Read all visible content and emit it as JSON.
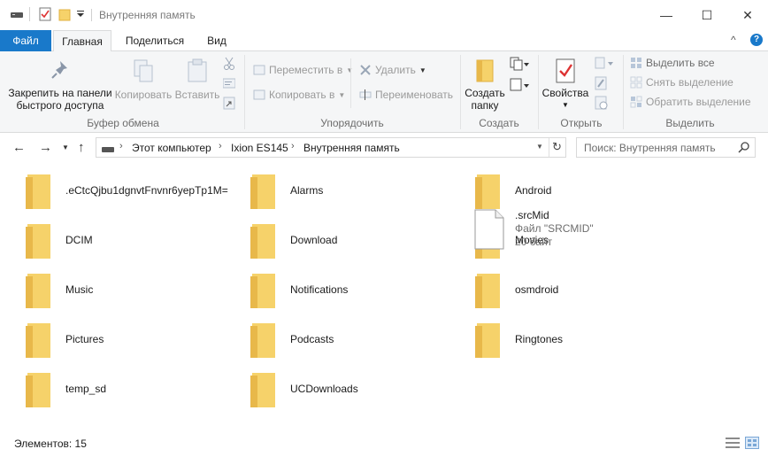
{
  "window": {
    "title": "Внутренняя память",
    "minimize_glyph": "—",
    "maximize_glyph": "☐",
    "close_glyph": "✕"
  },
  "ribbon_tabs": {
    "file": "Файл",
    "home": "Главная",
    "share": "Поделиться",
    "view": "Вид",
    "collapse_glyph": "^",
    "help_glyph": "?"
  },
  "ribbon": {
    "clipboard": {
      "pin_line1": "Закрепить на панели",
      "pin_line2": "быстрого доступа",
      "copy": "Копировать",
      "paste": "Вставить",
      "group": "Буфер обмена"
    },
    "organize": {
      "move_to": "Переместить в",
      "copy_to": "Копировать в",
      "delete": "Удалить",
      "rename": "Переименовать",
      "group": "Упорядочить"
    },
    "new": {
      "new_folder_line1": "Создать",
      "new_folder_line2": "папку",
      "group": "Создать"
    },
    "open": {
      "properties": "Свойства",
      "group": "Открыть"
    },
    "select": {
      "select_all": "Выделить все",
      "select_none": "Снять выделение",
      "invert": "Обратить выделение",
      "group": "Выделить"
    }
  },
  "address": {
    "crumbs": [
      "Этот компьютер",
      "Ixion ES145",
      "Внутренняя память"
    ],
    "search_placeholder": "Поиск: Внутренняя память"
  },
  "folders": [
    ".eCtcQjbu1dgnvtFnvnr6yepTp1M=",
    "Alarms",
    "Android",
    "DCIM",
    "Download",
    "Movies",
    "Music",
    "Notifications",
    "osmdroid",
    "Pictures",
    "Podcasts",
    "Ringtones",
    "temp_sd",
    "UCDownloads"
  ],
  "file": {
    "name": ".srcMid",
    "type": "Файл \"SRCMID\"",
    "size": "20 байт"
  },
  "status": {
    "count": "Элементов: 15"
  },
  "colors": {
    "accent": "#1979ca",
    "folder": "#f6d26a",
    "folder_dark": "#e8b84a"
  }
}
